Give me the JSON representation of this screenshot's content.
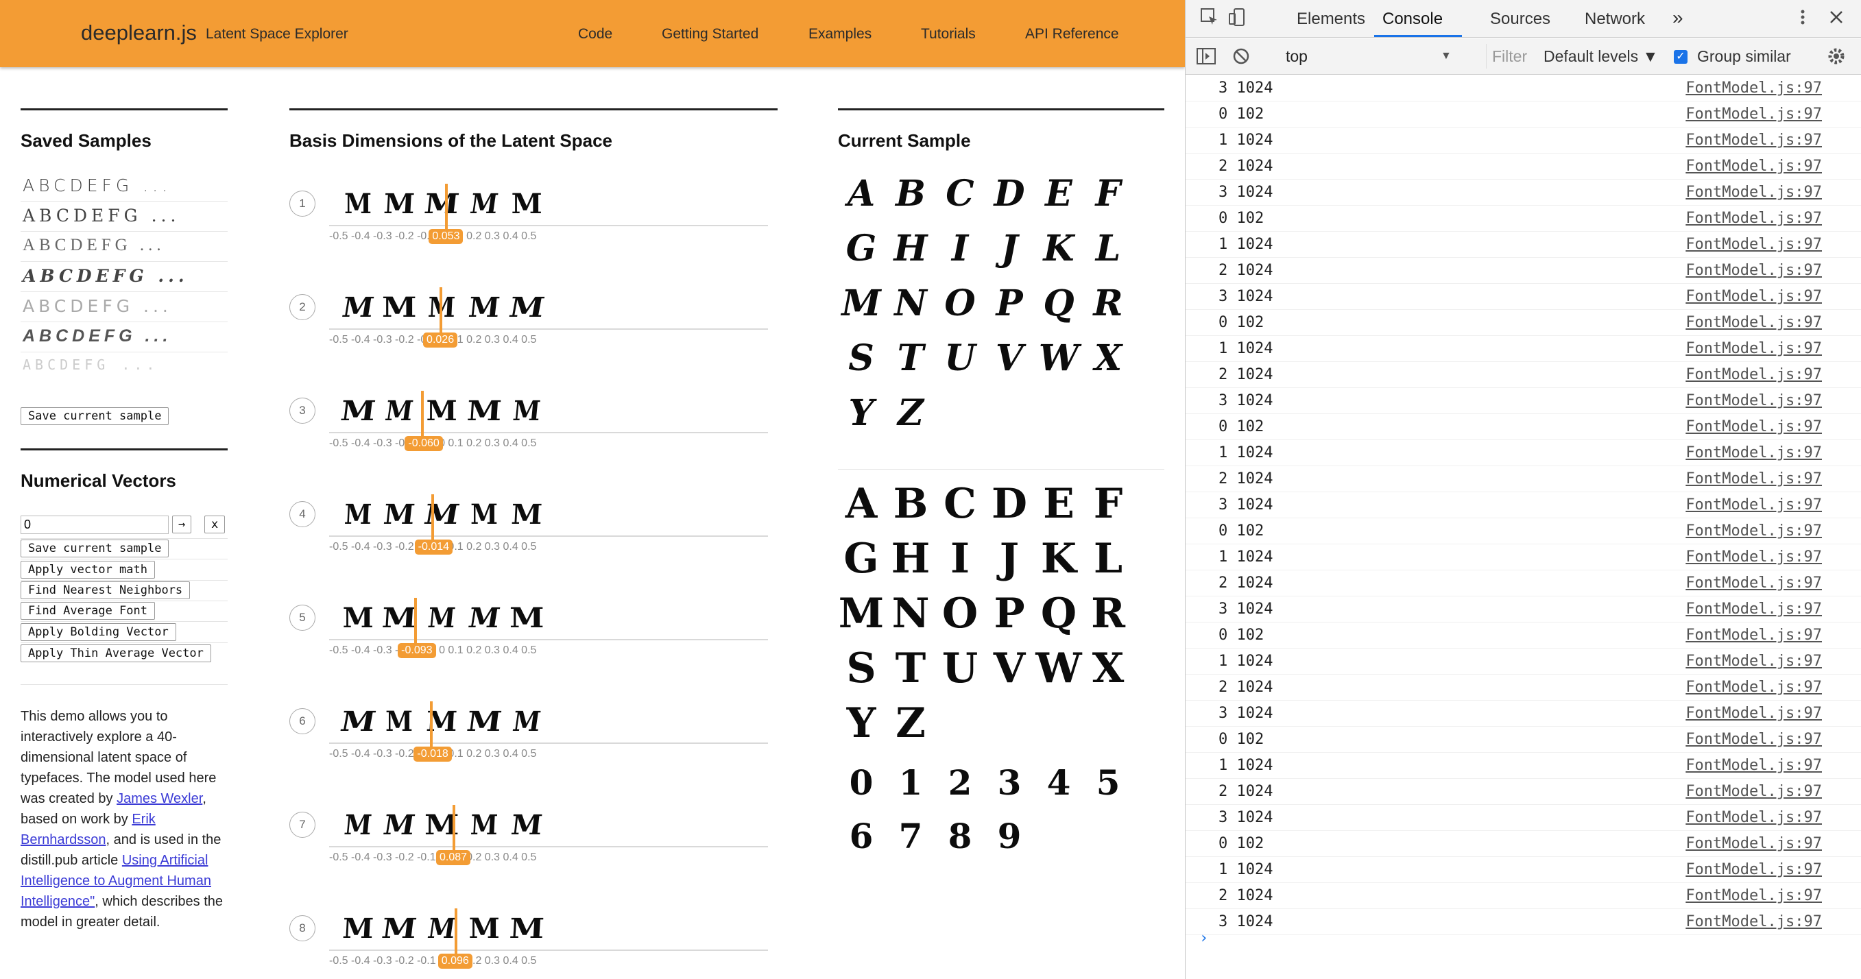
{
  "header": {
    "brand": "deeplearn.js",
    "subtitle": "Latent Space Explorer",
    "nav": [
      "Code",
      "Getting Started",
      "Examples",
      "Tutorials",
      "API Reference"
    ]
  },
  "saved_samples": {
    "title": "Saved Samples",
    "items": [
      "ABCDEFG ...",
      "ABCDEFG ...",
      "ABCDEFG ...",
      "ABCDEFG ...",
      "ABCDEFG ...",
      "ABCDEFG ...",
      "ABCDEFG ..."
    ],
    "save_button": "Save current sample"
  },
  "numerical_vectors": {
    "title": "Numerical Vectors",
    "input_value": "0",
    "go_button": "→",
    "clear_button": "x",
    "buttons": [
      "Save current sample",
      "Apply vector math",
      "Find Nearest Neighbors",
      "Find Average Font",
      "Apply Bolding Vector",
      "Apply Thin Average Vector"
    ]
  },
  "description": {
    "p1": "This demo allows you to interactively explore a 40-dimensional latent space of typefaces. The model used here was created by ",
    "link1": "James Wexler",
    "p2": ", based on work by ",
    "link2": "Erik Bernhardsson",
    "p3": ", and is used in the distill.pub article ",
    "link3": "Using Artificial Intelligence to Augment Human Intelligence\"",
    "p4": ", which describes the model in greater detail."
  },
  "basis": {
    "title": "Basis Dimensions of the Latent Space",
    "tick_labels": "-0.5 -0.4 -0.3 -0.2 -0.1  0  0.1  0.2  0.3  0.4  0.5",
    "dims": [
      {
        "num": "1",
        "sample": "MMMMM",
        "value": "0.053",
        "pos": 0.553
      },
      {
        "num": "2",
        "sample": "MMMMM",
        "value": "0.026",
        "pos": 0.526
      },
      {
        "num": "3",
        "sample": "MMMMM",
        "value": "-0.060",
        "pos": 0.44
      },
      {
        "num": "4",
        "sample": "MMMMM",
        "value": "-0.014",
        "pos": 0.486
      },
      {
        "num": "5",
        "sample": "MMMMM",
        "value": "-0.093",
        "pos": 0.407
      },
      {
        "num": "6",
        "sample": "MMMMM",
        "value": "-0.018",
        "pos": 0.482
      },
      {
        "num": "7",
        "sample": "MMMMM",
        "value": "0.087",
        "pos": 0.587
      },
      {
        "num": "8",
        "sample": "MMMMM",
        "value": "0.096",
        "pos": 0.596
      }
    ]
  },
  "current_sample": {
    "title": "Current Sample",
    "grid1": [
      "A",
      "B",
      "C",
      "D",
      "E",
      "F",
      "G",
      "H",
      "I",
      "J",
      "K",
      "L",
      "M",
      "N",
      "O",
      "P",
      "Q",
      "R",
      "S",
      "T",
      "U",
      "V",
      "W",
      "X",
      "Y",
      "Z"
    ],
    "grid2": [
      "A",
      "B",
      "C",
      "D",
      "E",
      "F",
      "G",
      "H",
      "I",
      "J",
      "K",
      "L",
      "M",
      "N",
      "O",
      "P",
      "Q",
      "R",
      "S",
      "T",
      "U",
      "V",
      "W",
      "X",
      "Y",
      "Z"
    ],
    "digits": [
      "0",
      "1",
      "2",
      "3",
      "4",
      "5",
      "6",
      "7",
      "8",
      "9"
    ]
  },
  "devtools": {
    "tabs": [
      "Elements",
      "Console",
      "Sources",
      "Network"
    ],
    "more": "»",
    "context": "top",
    "filter_placeholder": "Filter",
    "levels": "Default levels ▼",
    "group_similar": "Group similar",
    "logs": [
      {
        "msg": "3 1024",
        "src": "FontModel.js:97"
      },
      {
        "msg": "0 102",
        "src": "FontModel.js:97"
      },
      {
        "msg": "1 1024",
        "src": "FontModel.js:97"
      },
      {
        "msg": "2 1024",
        "src": "FontModel.js:97"
      },
      {
        "msg": "3 1024",
        "src": "FontModel.js:97"
      },
      {
        "msg": "0 102",
        "src": "FontModel.js:97"
      },
      {
        "msg": "1 1024",
        "src": "FontModel.js:97"
      },
      {
        "msg": "2 1024",
        "src": "FontModel.js:97"
      },
      {
        "msg": "3 1024",
        "src": "FontModel.js:97"
      },
      {
        "msg": "0 102",
        "src": "FontModel.js:97"
      },
      {
        "msg": "1 1024",
        "src": "FontModel.js:97"
      },
      {
        "msg": "2 1024",
        "src": "FontModel.js:97"
      },
      {
        "msg": "3 1024",
        "src": "FontModel.js:97"
      },
      {
        "msg": "0 102",
        "src": "FontModel.js:97"
      },
      {
        "msg": "1 1024",
        "src": "FontModel.js:97"
      },
      {
        "msg": "2 1024",
        "src": "FontModel.js:97"
      },
      {
        "msg": "3 1024",
        "src": "FontModel.js:97"
      },
      {
        "msg": "0 102",
        "src": "FontModel.js:97"
      },
      {
        "msg": "1 1024",
        "src": "FontModel.js:97"
      },
      {
        "msg": "2 1024",
        "src": "FontModel.js:97"
      },
      {
        "msg": "3 1024",
        "src": "FontModel.js:97"
      },
      {
        "msg": "0 102",
        "src": "FontModel.js:97"
      },
      {
        "msg": "1 1024",
        "src": "FontModel.js:97"
      },
      {
        "msg": "2 1024",
        "src": "FontModel.js:97"
      },
      {
        "msg": "3 1024",
        "src": "FontModel.js:97"
      },
      {
        "msg": "0 102",
        "src": "FontModel.js:97"
      },
      {
        "msg": "1 1024",
        "src": "FontModel.js:97"
      },
      {
        "msg": "2 1024",
        "src": "FontModel.js:97"
      },
      {
        "msg": "3 1024",
        "src": "FontModel.js:97"
      },
      {
        "msg": "0 102",
        "src": "FontModel.js:97"
      },
      {
        "msg": "1 1024",
        "src": "FontModel.js:97"
      },
      {
        "msg": "2 1024",
        "src": "FontModel.js:97"
      },
      {
        "msg": "3 1024",
        "src": "FontModel.js:97"
      }
    ],
    "prompt": "›"
  },
  "colors": {
    "accent": "#f39c34",
    "link": "#3b3bd6",
    "dt_blue": "#1a73e8"
  }
}
